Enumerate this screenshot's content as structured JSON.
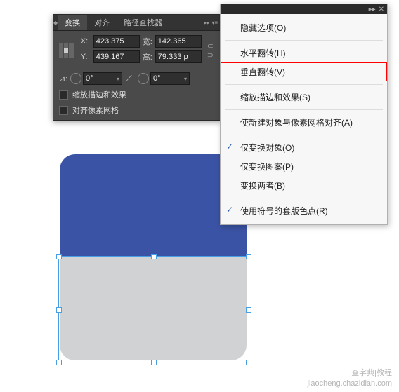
{
  "panel": {
    "tabs": {
      "transform": "变换",
      "align": "对齐",
      "pathfinder": "路径查找器"
    },
    "x_label": "X:",
    "y_label": "Y:",
    "w_label": "宽:",
    "h_label": "高:",
    "x_value": "423.375",
    "y_value": "439.167",
    "w_value": "142.365",
    "h_value": "79.333 p",
    "angle_label": "⊿:",
    "angle_value": "0°",
    "shear_value": "0°",
    "scale_strokes": "缩放描边和效果",
    "align_pixel_grid": "对齐像素网格"
  },
  "menu": {
    "hide_options": "隐藏选项(O)",
    "flip_h": "水平翻转(H)",
    "flip_v": "垂直翻转(V)",
    "scale_strokes": "缩放描边和效果(S)",
    "align_new_pixel": "使新建对象与像素网格对齐(A)",
    "transform_object": "仅变换对象(O)",
    "transform_pattern": "仅变换图案(P)",
    "transform_both": "变换两者(B)",
    "use_symbol_reg": "使用符号的套版色点(R)"
  },
  "watermark": {
    "line1": "查字典",
    "line2": "教程",
    "url": "jiaocheng.chazidian.com"
  }
}
